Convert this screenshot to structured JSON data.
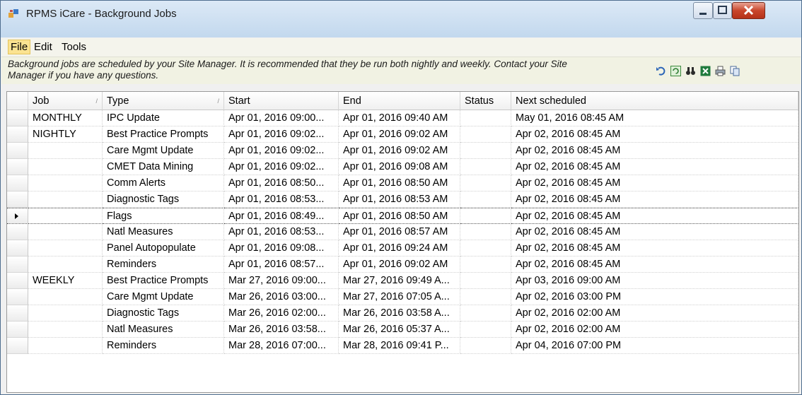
{
  "window": {
    "title": "RPMS iCare - Background Jobs"
  },
  "menu": [
    "File",
    "Edit",
    "Tools"
  ],
  "info": {
    "text": "Background jobs are scheduled by your Site Manager.  It is recommended that they be run both nightly and weekly.  Contact your Site Manager if you have any questions."
  },
  "toolbar_icons": [
    "undo-icon",
    "refresh-icon",
    "find-icon",
    "excel-icon",
    "print-icon",
    "copy-icon"
  ],
  "table": {
    "columns": [
      "Job",
      "Type",
      "Start",
      "End",
      "Status",
      "Next scheduled"
    ],
    "rows": [
      {
        "job": "MONTHLY",
        "type": "IPC Update",
        "start": "Apr 01, 2016 09:00...",
        "end": "Apr 01, 2016 09:40 AM",
        "status": "",
        "next": "May 01, 2016 08:45 AM"
      },
      {
        "job": "NIGHTLY",
        "type": "Best Practice Prompts",
        "start": "Apr 01, 2016 09:02...",
        "end": "Apr 01, 2016 09:02 AM",
        "status": "",
        "next": "Apr 02, 2016 08:45 AM"
      },
      {
        "job": "",
        "type": "Care Mgmt Update",
        "start": "Apr 01, 2016 09:02...",
        "end": "Apr 01, 2016 09:02 AM",
        "status": "",
        "next": "Apr 02, 2016 08:45 AM"
      },
      {
        "job": "",
        "type": "CMET Data Mining",
        "start": "Apr 01, 2016 09:02...",
        "end": "Apr 01, 2016 09:08 AM",
        "status": "",
        "next": "Apr 02, 2016 08:45 AM"
      },
      {
        "job": "",
        "type": "Comm Alerts",
        "start": "Apr 01, 2016 08:50...",
        "end": "Apr 01, 2016 08:50 AM",
        "status": "",
        "next": "Apr 02, 2016 08:45 AM"
      },
      {
        "job": "",
        "type": "Diagnostic Tags",
        "start": "Apr 01, 2016 08:53...",
        "end": "Apr 01, 2016 08:53 AM",
        "status": "",
        "next": "Apr 02, 2016 08:45 AM"
      },
      {
        "job": "",
        "type": "Flags",
        "start": "Apr 01, 2016 08:49...",
        "end": "Apr 01, 2016 08:50 AM",
        "status": "",
        "next": "Apr 02, 2016 08:45 AM"
      },
      {
        "job": "",
        "type": "Natl Measures",
        "start": "Apr 01, 2016 08:53...",
        "end": "Apr 01, 2016 08:57 AM",
        "status": "",
        "next": "Apr 02, 2016 08:45 AM"
      },
      {
        "job": "",
        "type": "Panel Autopopulate",
        "start": "Apr 01, 2016 09:08...",
        "end": "Apr 01, 2016 09:24 AM",
        "status": "",
        "next": "Apr 02, 2016 08:45 AM"
      },
      {
        "job": "",
        "type": "Reminders",
        "start": "Apr 01, 2016 08:57...",
        "end": "Apr 01, 2016 09:02 AM",
        "status": "",
        "next": "Apr 02, 2016 08:45 AM"
      },
      {
        "job": "WEEKLY",
        "type": "Best Practice Prompts",
        "start": "Mar 27, 2016 09:00...",
        "end": "Mar 27, 2016 09:49 A...",
        "status": "",
        "next": "Apr 03, 2016 09:00 AM"
      },
      {
        "job": "",
        "type": "Care Mgmt Update",
        "start": "Mar 26, 2016 03:00...",
        "end": "Mar 27, 2016 07:05 A...",
        "status": "",
        "next": "Apr 02, 2016 03:00 PM"
      },
      {
        "job": "",
        "type": "Diagnostic Tags",
        "start": "Mar 26, 2016 02:00...",
        "end": "Mar 26, 2016 03:58 A...",
        "status": "",
        "next": "Apr 02, 2016 02:00 AM"
      },
      {
        "job": "",
        "type": "Natl Measures",
        "start": "Mar 26, 2016 03:58...",
        "end": "Mar 26, 2016 05:37 A...",
        "status": "",
        "next": "Apr 02, 2016 02:00 AM"
      },
      {
        "job": "",
        "type": "Reminders",
        "start": "Mar 28, 2016 07:00...",
        "end": "Mar 28, 2016 09:41 P...",
        "status": "",
        "next": "Apr 04, 2016 07:00 PM"
      }
    ],
    "selected_row": 6
  }
}
